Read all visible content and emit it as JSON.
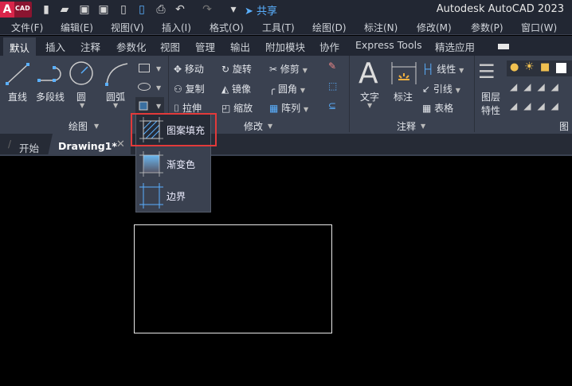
{
  "title_bar": {
    "logo": "A CAD",
    "share": "共享",
    "app_title": "Autodesk AutoCAD 2023"
  },
  "menu": [
    "文件(F)",
    "编辑(E)",
    "视图(V)",
    "插入(I)",
    "格式(O)",
    "工具(T)",
    "绘图(D)",
    "标注(N)",
    "修改(M)",
    "参数(P)",
    "窗口(W)"
  ],
  "ribbon_tabs": [
    "默认",
    "插入",
    "注释",
    "参数化",
    "视图",
    "管理",
    "输出",
    "附加模块",
    "协作",
    "Express Tools",
    "精选应用"
  ],
  "draw": {
    "line": "直线",
    "polyline": "多段线",
    "circle": "圆",
    "arc": "圆弧",
    "panel": "绘图"
  },
  "modify": {
    "move": "移动",
    "rotate": "旋转",
    "trim": "修剪",
    "copy": "复制",
    "mirror": "镜像",
    "fillet": "圆角",
    "stretch": "拉伸",
    "scale": "缩放",
    "array": "阵列",
    "panel": "修改"
  },
  "annotation": {
    "text": "文字",
    "dimension": "标注",
    "linear": "线性",
    "leader": "引线",
    "table": "表格",
    "panel": "注释"
  },
  "layers": {
    "props1": "图层",
    "props2": "特性",
    "panel": "图层"
  },
  "doc_tabs": {
    "start": "开始",
    "drawing": "Drawing1*"
  },
  "hatch_menu": [
    "图案填充",
    "渐变色",
    "边界"
  ]
}
